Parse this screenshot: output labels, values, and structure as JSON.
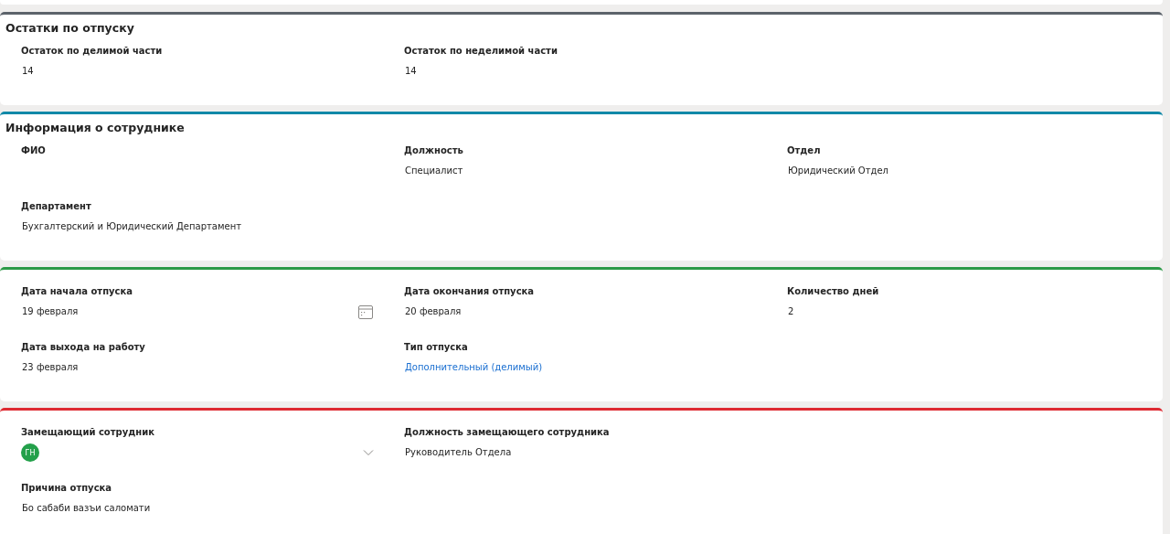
{
  "sections": [
    {
      "title": "Остатки по отпуску",
      "color": "#5c636b",
      "rows": [
        [
          {
            "kind": "text",
            "label": "Остаток по делимой части",
            "value": "14"
          },
          {
            "kind": "text",
            "label": "Остаток по неделимой части",
            "value": "14"
          }
        ]
      ]
    },
    {
      "title": "Информация о сотруднике",
      "color": "#1189a8",
      "rows": [
        [
          {
            "kind": "text",
            "label": "ФИО"
          },
          {
            "kind": "text",
            "label": "Должность",
            "value": "Специалист"
          },
          {
            "kind": "text",
            "label": "Отдел",
            "value": "Юридический Отдел"
          }
        ],
        [
          {
            "kind": "text",
            "label": "Департамент",
            "value": "Бухгалтерский и Юридический Департамент"
          }
        ]
      ]
    },
    {
      "color": "#2c9a47",
      "rows": [
        [
          {
            "kind": "date",
            "label": "Дата начала отпуска",
            "value": "19 февраля"
          },
          {
            "kind": "text",
            "label": "Дата окончания отпуска",
            "value": "20 февраля"
          },
          {
            "kind": "text",
            "label": "Количество дней",
            "value": "2"
          }
        ],
        [
          {
            "kind": "text",
            "label": "Дата выхода на работу",
            "value": "23 февраля"
          },
          {
            "kind": "link",
            "label": "Тип отпуска",
            "value": "Дополнительный (делимый)"
          }
        ]
      ]
    },
    {
      "color": "#de2a32",
      "rows": [
        [
          {
            "kind": "person",
            "label": "Замещающий сотрудник",
            "initials": "ГН"
          },
          {
            "kind": "text",
            "label": "Должность замещающего сотрудника",
            "value": "Руководитель Отдела"
          }
        ],
        [
          {
            "kind": "text",
            "label": "Причина отпуска",
            "value": "Бо сабаби вазъи саломати"
          }
        ]
      ]
    }
  ]
}
